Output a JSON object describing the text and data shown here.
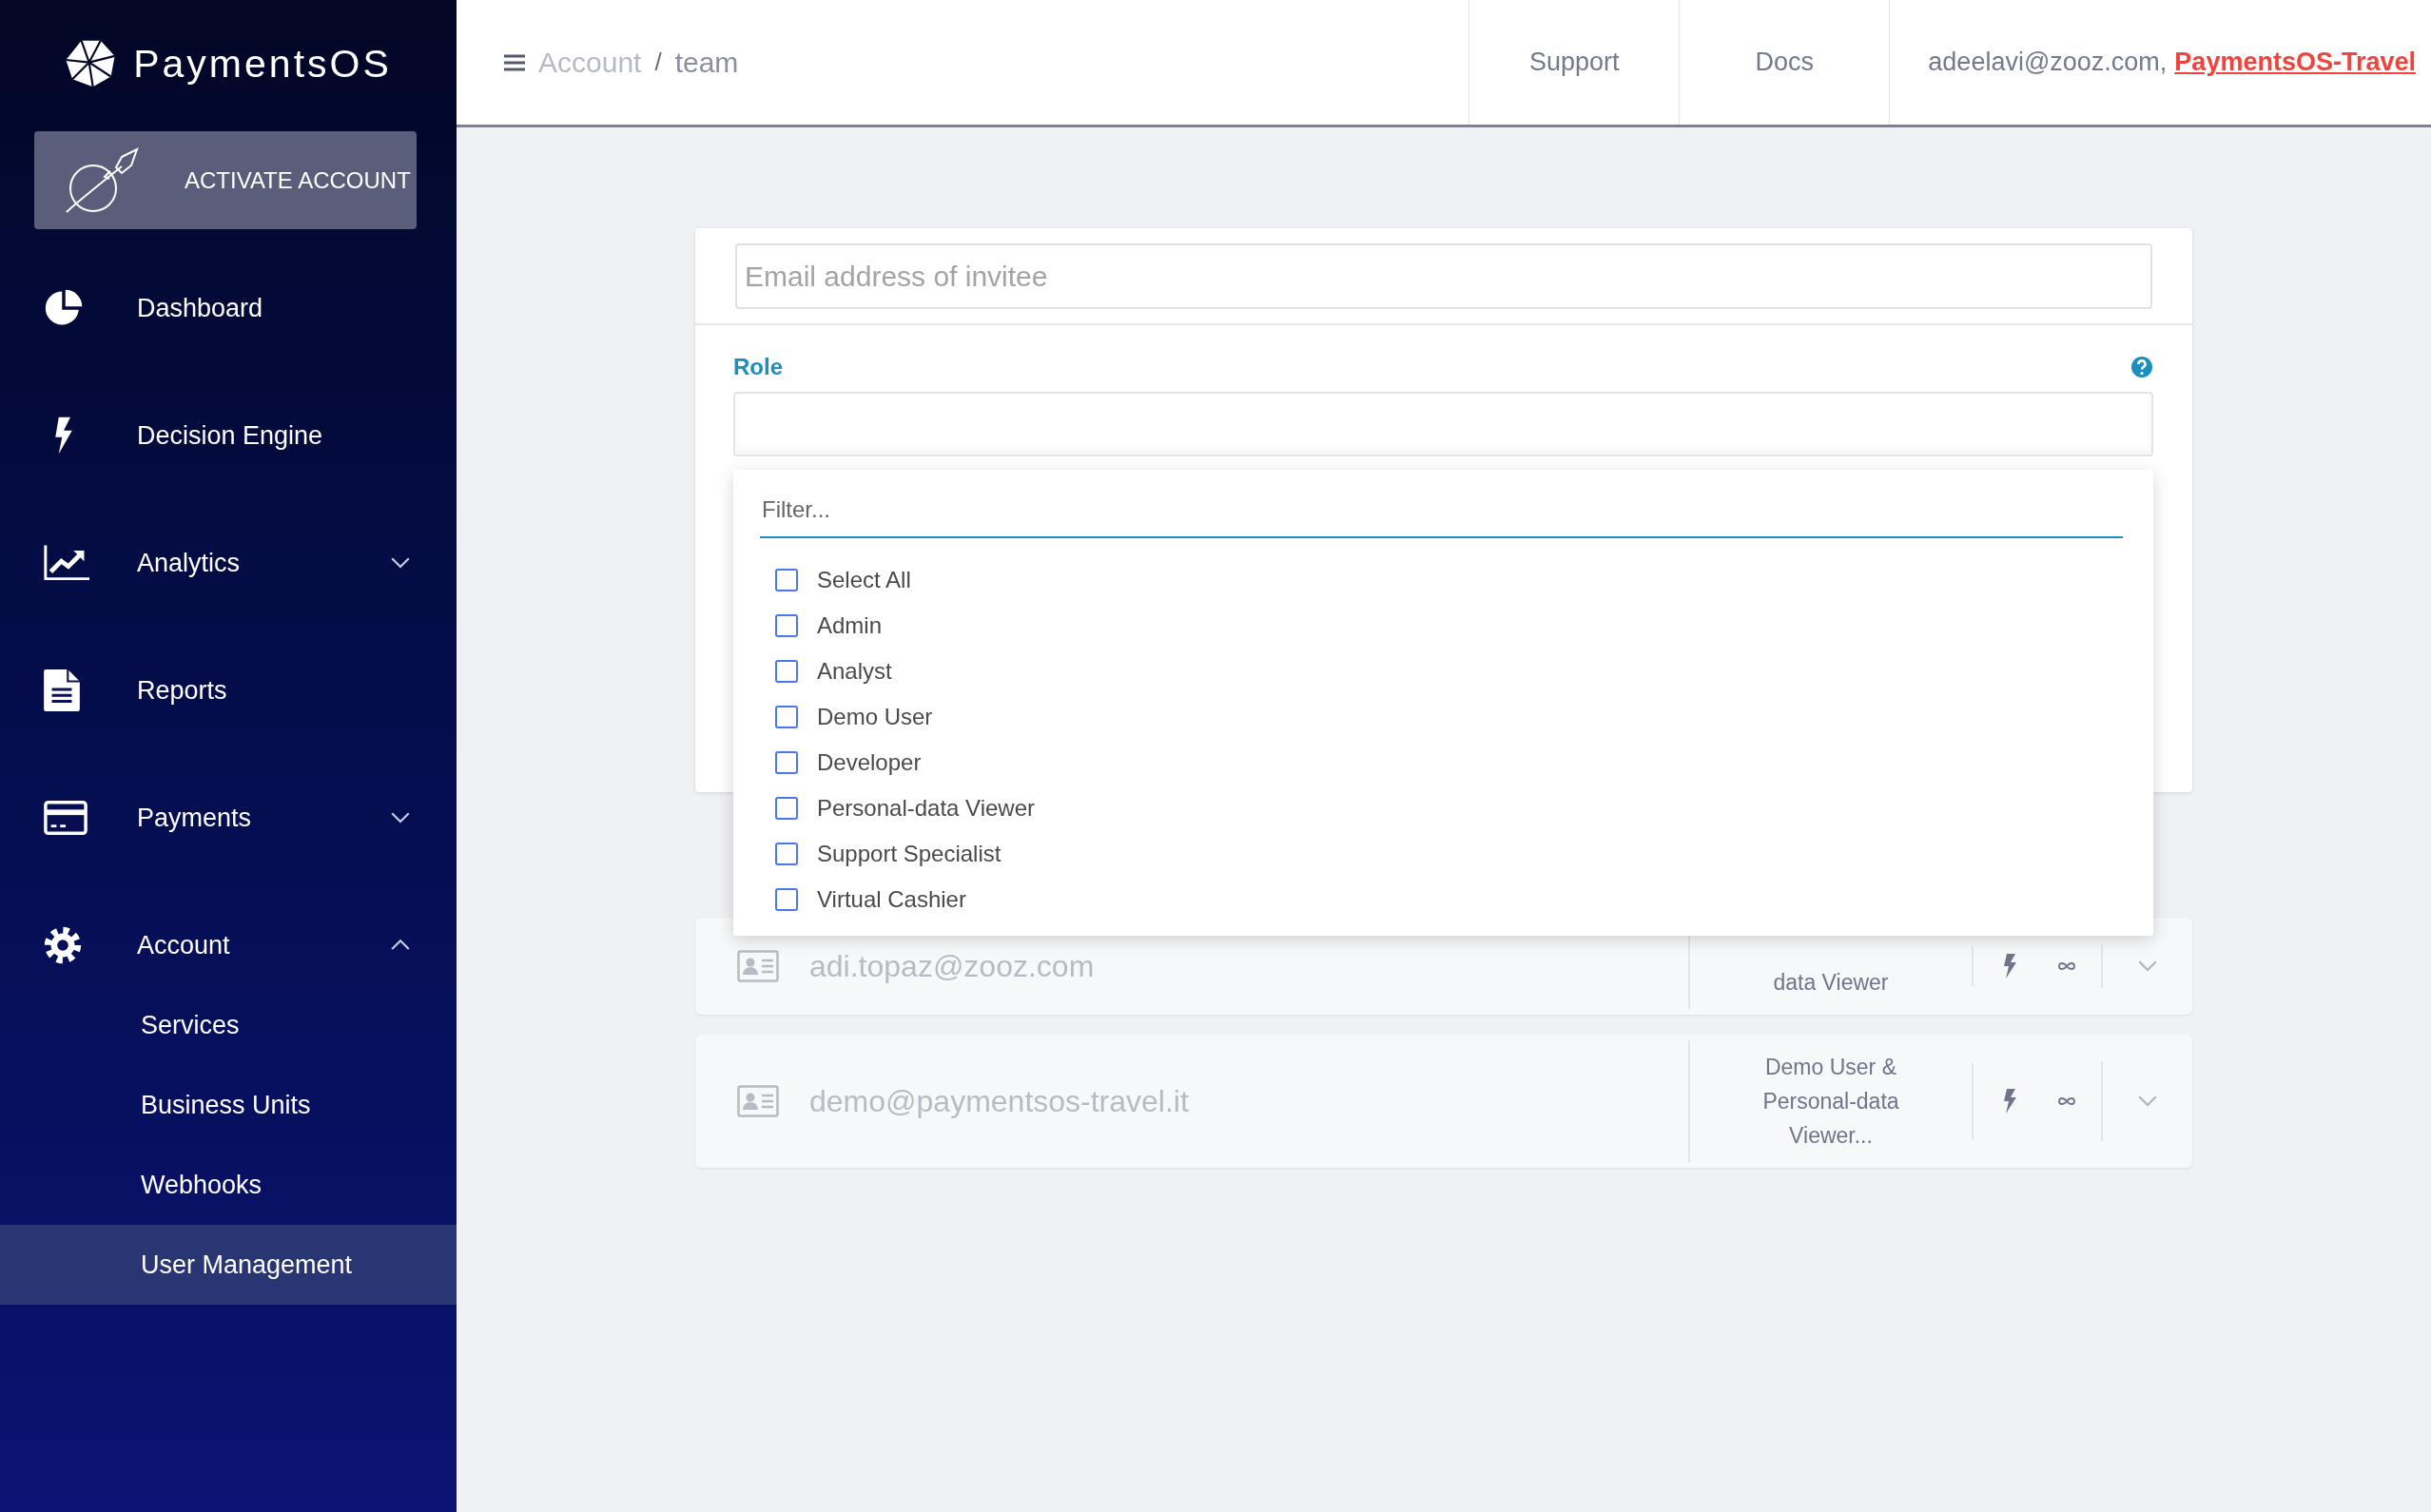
{
  "brand": {
    "name": "PaymentsOS"
  },
  "activate_button": {
    "label": "ACTIVATE ACCOUNT"
  },
  "nav": [
    {
      "label": "Dashboard",
      "kind": "link",
      "selected": false
    },
    {
      "label": "Decision Engine",
      "kind": "link",
      "selected": false
    },
    {
      "label": "Analytics",
      "kind": "group",
      "expanded": false,
      "selected": false
    },
    {
      "label": "Reports",
      "kind": "link",
      "selected": false
    },
    {
      "label": "Payments",
      "kind": "group",
      "expanded": false,
      "selected": false
    },
    {
      "label": "Account",
      "kind": "group",
      "expanded": true,
      "selected": false,
      "children": [
        {
          "label": "Services",
          "selected": false
        },
        {
          "label": "Business Units",
          "selected": false
        },
        {
          "label": "Webhooks",
          "selected": false
        },
        {
          "label": "User Management",
          "selected": true
        }
      ]
    }
  ],
  "header": {
    "breadcrumb": [
      "Account",
      "team"
    ],
    "separator": "/",
    "links": [
      "Support",
      "Docs"
    ],
    "user_email": "adeelavi@zooz.com,",
    "account_link": "PaymentsOS-Travel"
  },
  "invite": {
    "email_placeholder": "Email address of invitee",
    "role_label": "Role",
    "filter_placeholder": "Filter...",
    "options": [
      {
        "label": "Select All",
        "checked": false
      },
      {
        "label": "Admin",
        "checked": false
      },
      {
        "label": "Analyst",
        "checked": false
      },
      {
        "label": "Demo User",
        "checked": false
      },
      {
        "label": "Developer",
        "checked": false
      },
      {
        "label": "Personal-data Viewer",
        "checked": false
      },
      {
        "label": "Support Specialist",
        "checked": false
      },
      {
        "label": "Virtual Cashier",
        "checked": false
      }
    ]
  },
  "users": [
    {
      "email": "adi.topaz@zooz.com",
      "roles": "data Viewer"
    },
    {
      "email": "demo@paymentsos-travel.it",
      "roles": "Demo User & Personal-data Viewer..."
    }
  ]
}
